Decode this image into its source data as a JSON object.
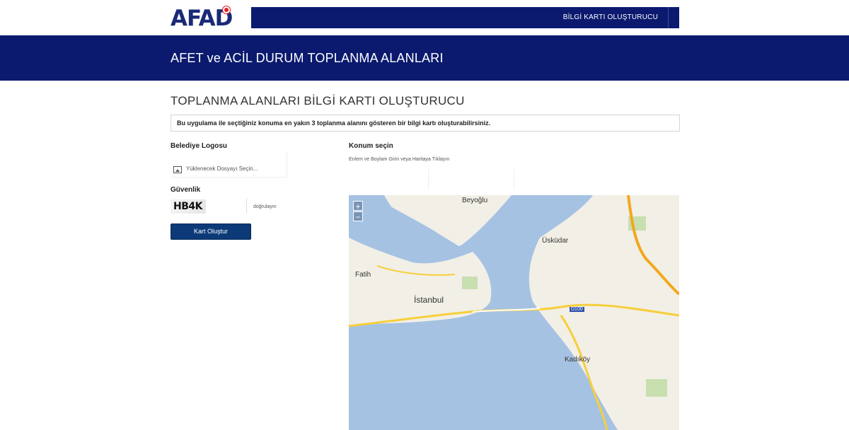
{
  "header": {
    "logo_text": "AFAD",
    "nav_item": "BİLGİ KARTI OLUŞTURUCU"
  },
  "banner": {
    "title": "AFET ve ACİL DURUM TOPLANMA ALANLARI"
  },
  "main": {
    "page_title": "TOPLANMA ALANLARI BİLGİ KARTI OLUŞTURUCU",
    "info_text": "Bu uygulama ile seçtiğiniz konuma en yakın 3 toplanma alanını gösteren bir bilgi kartı oluşturabilirsiniz."
  },
  "form": {
    "logo_label": "Belediye Logosu",
    "file_placeholder": "Yüklenecek Dosyayı Seçin...",
    "security_label": "Güvenlik",
    "captcha_text": "HB4K",
    "captcha_hint": "doğrulayın",
    "submit_label": "Kart Oluştur"
  },
  "location": {
    "label": "Konum seçin",
    "hint": "Enlem ve Boylam Girin veya Haritaya Tıklayın",
    "lat_value": "",
    "lon_value": ""
  },
  "map": {
    "zoom_in": "+",
    "zoom_out": "−",
    "labels": [
      "Beyoğlu",
      "Üsküdar",
      "Fatih",
      "İstanbul",
      "Kadıköy",
      "D100"
    ]
  }
}
